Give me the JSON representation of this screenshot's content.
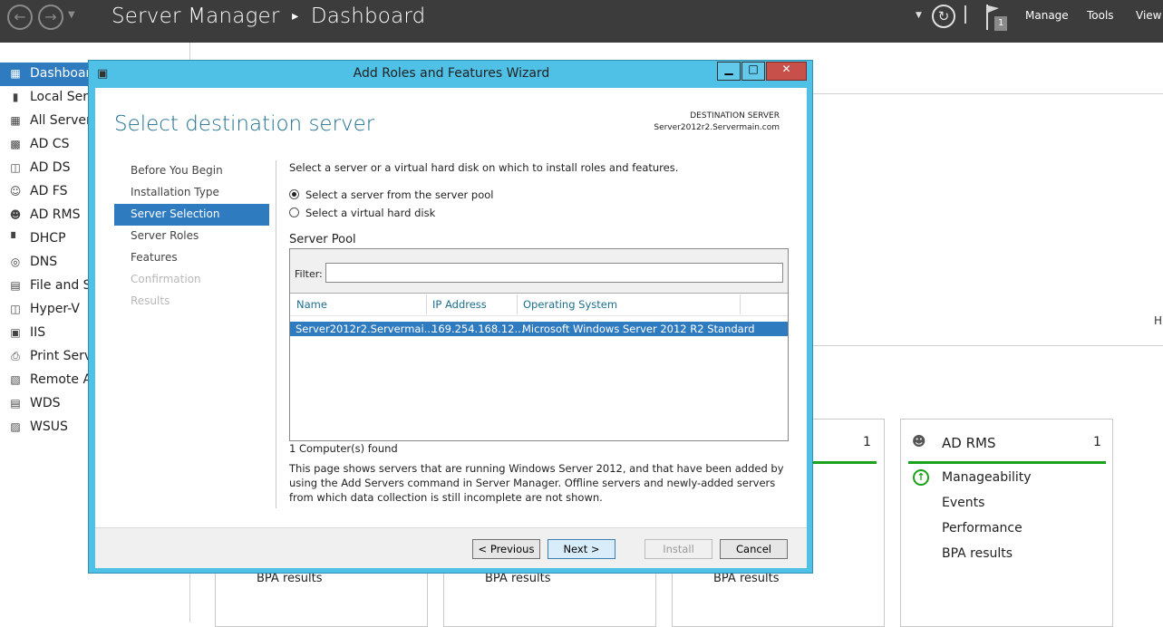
{
  "header": {
    "title": "Server Manager",
    "separator": "▸",
    "page": "Dashboard",
    "notification_count": "1",
    "menu": [
      "Manage",
      "Tools",
      "View"
    ]
  },
  "sidebar": {
    "items": [
      {
        "label": "Dashboard",
        "icon": "dashboard-icon",
        "active": true
      },
      {
        "label": "Local Server",
        "icon": "server-icon"
      },
      {
        "label": "All Servers",
        "icon": "servers-icon"
      },
      {
        "label": "AD CS",
        "icon": "certificate-icon"
      },
      {
        "label": "AD DS",
        "icon": "directory-icon"
      },
      {
        "label": "AD FS",
        "icon": "federation-icon"
      },
      {
        "label": "AD RMS",
        "icon": "rights-icon"
      },
      {
        "label": "DHCP",
        "icon": "dhcp-icon"
      },
      {
        "label": "DNS",
        "icon": "dns-icon"
      },
      {
        "label": "File and Storage Services",
        "icon": "storage-icon"
      },
      {
        "label": "Hyper-V",
        "icon": "hyperv-icon"
      },
      {
        "label": "IIS",
        "icon": "iis-icon"
      },
      {
        "label": "Print Services",
        "icon": "printer-icon"
      },
      {
        "label": "Remote Access",
        "icon": "remote-icon"
      },
      {
        "label": "WDS",
        "icon": "wds-icon"
      },
      {
        "label": "WSUS",
        "icon": "wsus-icon"
      }
    ]
  },
  "dashboard": {
    "hidden_letter": "H",
    "tile_counts": [
      "1",
      "1"
    ],
    "tiles": [
      {
        "bpa": "BPA results"
      },
      {
        "bpa": "BPA results"
      },
      {
        "bpa": "BPA results"
      }
    ],
    "ad_rms_tile": {
      "title": "AD RMS",
      "count": "1",
      "items": [
        "Manageability",
        "Events",
        "Performance",
        "BPA results"
      ]
    }
  },
  "wizard": {
    "title": "Add Roles and Features Wizard",
    "heading": "Select destination server",
    "dest_label": "DESTINATION SERVER",
    "dest_value": "Server2012r2.Servermain.com",
    "steps": [
      {
        "label": "Before You Begin",
        "state": "normal"
      },
      {
        "label": "Installation Type",
        "state": "normal"
      },
      {
        "label": "Server Selection",
        "state": "active"
      },
      {
        "label": "Server Roles",
        "state": "normal"
      },
      {
        "label": "Features",
        "state": "normal"
      },
      {
        "label": "Confirmation",
        "state": "disabled"
      },
      {
        "label": "Results",
        "state": "disabled"
      }
    ],
    "instruction": "Select a server or a virtual hard disk on which to install roles and features.",
    "options": [
      {
        "label": "Select a server from the server pool",
        "selected": true
      },
      {
        "label": "Select a virtual hard disk",
        "selected": false
      }
    ],
    "pool_label": "Server Pool",
    "filter_label": "Filter:",
    "filter_value": "",
    "columns": [
      "Name",
      "IP Address",
      "Operating System"
    ],
    "rows": [
      {
        "name": "Server2012r2.Servermai...",
        "ip": "169.254.168.12...",
        "os": "Microsoft Windows Server 2012 R2 Standard"
      }
    ],
    "found": "1 Computer(s) found",
    "note": "This page shows servers that are running Windows Server 2012, and that have been added by using the Add Servers command in Server Manager. Offline servers and newly-added servers from which data collection is still incomplete are not shown.",
    "buttons": {
      "previous": "< Previous",
      "next": "Next >",
      "install": "Install",
      "cancel": "Cancel"
    }
  }
}
